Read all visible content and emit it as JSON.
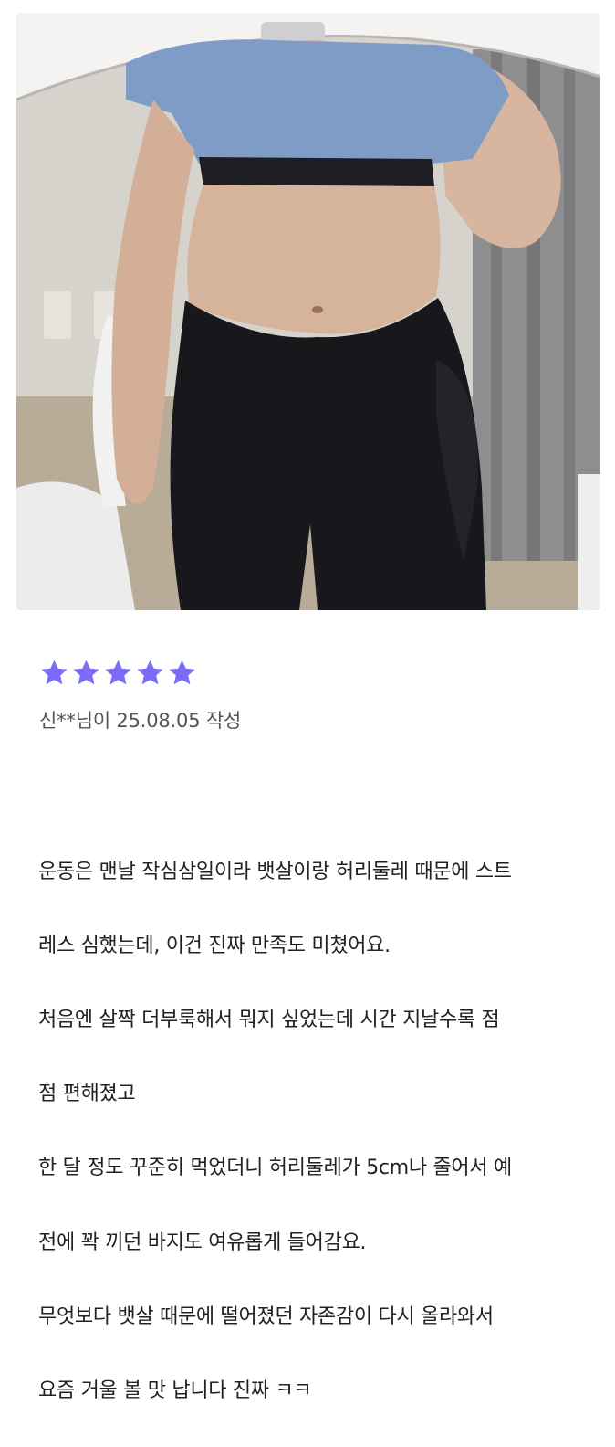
{
  "review": {
    "photo_alt": "review-photo",
    "rating": 5,
    "star_color": "#7b6cf6",
    "author_line": "신**님이 25.08.05 작성",
    "body_lines": [
      "운동은 맨날 작심삼일이라 뱃살이랑 허리둘레 때문에 스트",
      "레스 심했는데, 이건 진짜 만족도 미쳤어요.",
      "처음엔 살짝 더부룩해서 뭐지 싶었는데 시간 지날수록 점",
      "점 편해졌고",
      "한 달 정도 꾸준히 먹었더니 허리둘레가 5cm나 줄어서 예",
      "전에 꽉 끼던 바지도 여유롭게 들어감요.",
      "무엇보다 뱃살 때문에 떨어졌던 자존감이 다시 올라와서",
      "요즘 거울 볼 맛 납니다 진짜 ㅋㅋ"
    ]
  }
}
